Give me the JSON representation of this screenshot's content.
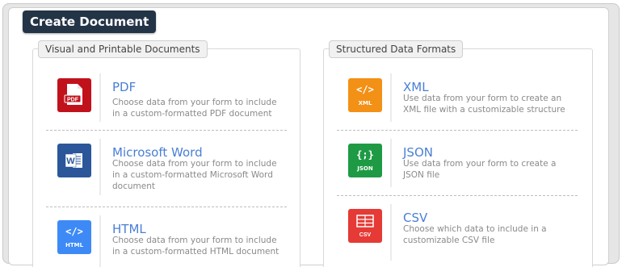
{
  "header": {
    "title": "Create Document"
  },
  "groups": [
    {
      "legend": "Visual and Printable Documents",
      "items": [
        {
          "icon": "pdf-file-icon",
          "caption": "PDF",
          "color": "#c1121c",
          "title": "PDF",
          "description": "Choose data from your form to include in a custom-formatted PDF document"
        },
        {
          "icon": "word-document-icon",
          "caption": "W",
          "color": "#2b579a",
          "title": "Microsoft Word",
          "description": "Choose data from your form to include in a custom-formatted Microsoft Word document"
        },
        {
          "icon": "html-code-icon",
          "glyph": "</>",
          "caption": "HTML",
          "color": "#3d8af7",
          "title": "HTML",
          "description": "Choose data from your form to include in a custom-formatted HTML document"
        }
      ]
    },
    {
      "legend": "Structured Data Formats",
      "items": [
        {
          "icon": "xml-code-icon",
          "glyph": "</>",
          "caption": "XML",
          "color": "#f39016",
          "title": "XML",
          "description": "Use data from your form to create an XML file with a customizable structure"
        },
        {
          "icon": "json-braces-icon",
          "glyph": "{;}",
          "caption": "JSON",
          "color": "#1e9a45",
          "title": "JSON",
          "description": "Use data from your form to create a JSON file"
        },
        {
          "icon": "csv-table-icon",
          "caption": "CSV",
          "color": "#e53a35",
          "title": "CSV",
          "description": "Choose which data to include in a customizable CSV file"
        }
      ]
    }
  ]
}
